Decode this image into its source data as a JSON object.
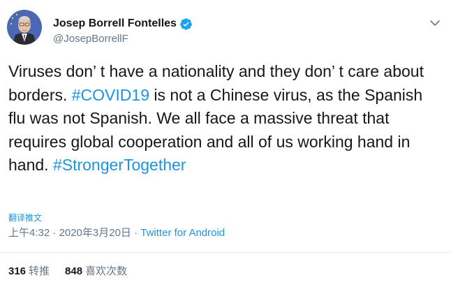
{
  "author": {
    "display_name": "Josep Borrell Fontelles",
    "handle": "@JosepBorrellF",
    "verified": true,
    "avatar_icon": "profile-photo",
    "verified_icon": "verified-badge-icon"
  },
  "tweet": {
    "text_1": "Viruses don’ t have a nationality and they don’ t care about borders. ",
    "hashtag_1": "#COVID19",
    "text_2": " is not a Chinese virus, as the Spanish flu was not Spanish. We all face a massive threat that requires global cooperation and all of us working hand in hand. ",
    "hashtag_2": "#StrongerTogether",
    "translate_label": "翻译推文",
    "timestamp": "上午4:32 · 2020年3月20日 · ",
    "source": "Twitter for Android"
  },
  "stats": {
    "retweets_count": "316",
    "retweets_label": "转推",
    "likes_count": "848",
    "likes_label": "喜欢次数"
  },
  "colors": {
    "link": "#1b95e0",
    "muted": "#657786",
    "text": "#14171a",
    "divider": "#e6ecf0"
  }
}
